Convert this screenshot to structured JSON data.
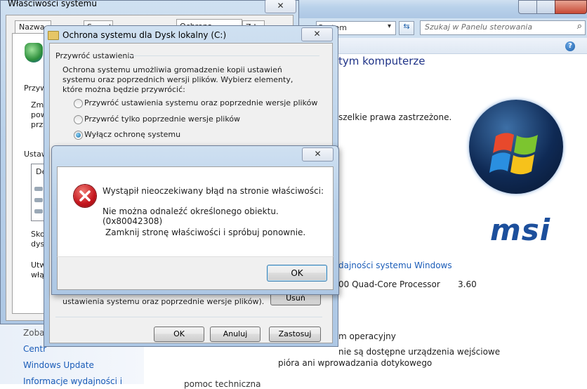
{
  "system_props": {
    "title": "Właściwości systemu",
    "tabs": [
      "Nazwa k",
      "Sprzęt",
      "Ochrona systemu",
      "Zd"
    ],
    "left_texts": [
      "Przyw",
      "Zmi",
      "pow",
      "przy",
      "Ustaw",
      "De",
      "Sko",
      "dysk",
      "Utw",
      "włą"
    ]
  },
  "control_panel": {
    "breadcrumb": "System",
    "search_placeholder": "Szukaj w Panelu sterowania",
    "heading": "tym komputerze",
    "copyright": "szelkie prawa zastrzeżone.",
    "perf_link": "dajności systemu Windows",
    "processor": "00 Quad-Core Processor",
    "speed": "3.60",
    "system_type": "m operacyjny",
    "pen_line1": "nie są dostępne urządzenia wejściowe",
    "pen_line2": "pióra ani wprowadzania dotykowego",
    "bottom_cut": "pomoc techniczna",
    "sidebar": [
      "Zoba",
      "Centr",
      "Windows Update",
      "Informacje wydajności i"
    ],
    "msi_logo": "msi"
  },
  "protection_dialog": {
    "title": "Ochrona systemu dla Dysk lokalny (C:)",
    "group_label": "Przywróć ustawienia",
    "description": "Ochrona systemu umożliwia gromadzenie kopii ustawień systemu oraz poprzednich wersji plików. Wybierz elementy, które można będzie przywrócić:",
    "options": [
      "Przywróć ustawienia systemu oraz poprzednie wersje plików",
      "Przywróć tylko poprzednie wersje plików",
      "Wyłącz ochronę systemu"
    ],
    "selected_option": 2,
    "lower_text": "ustawienia systemu oraz poprzednie wersje plików).",
    "delete_button": "Usuń",
    "ok_button": "OK",
    "cancel_button": "Anuluj",
    "apply_button": "Zastosuj"
  },
  "error_dialog": {
    "line1": "Wystąpił nieoczekiwany błąd na stronie właściwości:",
    "line2": "Nie można odnaleźć określonego obiektu. (0x80042308)",
    "line3": "Zamknij stronę właściwości i spróbuj ponownie.",
    "ok_button": "OK"
  },
  "colors": {
    "link": "#1a5cb8",
    "heading": "#1e3287",
    "msi": "#1c4f9c",
    "error_red": "#c4141c"
  }
}
